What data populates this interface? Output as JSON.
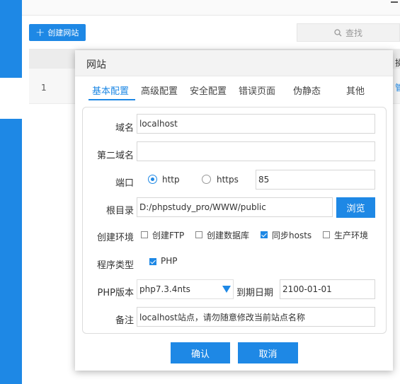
{
  "toolbar": {
    "create_label": "创建网站",
    "search_label": "查找"
  },
  "table": {
    "row_number": "1",
    "right_header_fragment": "操",
    "right_link_fragment": "管"
  },
  "modal": {
    "title": "网站",
    "tabs": [
      "基本配置",
      "高级配置",
      "安全配置",
      "错误页面",
      "伪静态",
      "其他"
    ],
    "active_tab": "基本配置",
    "form": {
      "domain": {
        "label": "域名",
        "value": "localhost"
      },
      "second_domain": {
        "label": "第二域名",
        "value": ""
      },
      "port": {
        "label": "端口",
        "http": "http",
        "https": "https",
        "selected": "http",
        "value": "85"
      },
      "root": {
        "label": "根目录",
        "value": "D:/phpstudy_pro/WWW/public",
        "browse_label": "浏览"
      },
      "env": {
        "label": "创建环境",
        "options": [
          {
            "label": "创建FTP",
            "checked": false
          },
          {
            "label": "创建数据库",
            "checked": false
          },
          {
            "label": "同步hosts",
            "checked": true
          },
          {
            "label": "生产环境",
            "checked": false
          }
        ]
      },
      "program_type": {
        "label": "程序类型",
        "option": "PHP",
        "checked": true
      },
      "php_version": {
        "label": "PHP版本",
        "value": "php7.3.4nts"
      },
      "expiry": {
        "label": "到期日期",
        "value": "2100-01-01"
      },
      "note": {
        "label": "备注",
        "value": "localhost站点，请勿随意修改当前站点名称"
      }
    },
    "confirm_label": "确认",
    "cancel_label": "取消"
  },
  "colors": {
    "accent": "#1e88e5"
  }
}
